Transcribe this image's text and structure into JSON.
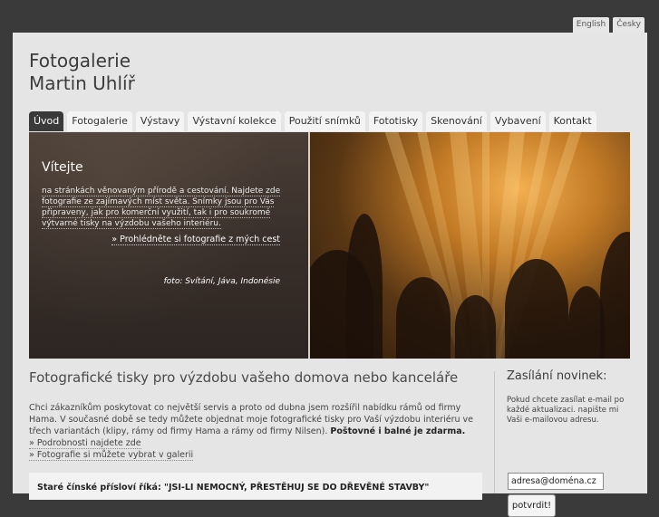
{
  "languages": [
    {
      "label": "English"
    },
    {
      "label": "Česky"
    }
  ],
  "site": {
    "title_line1": "Fotogalerie",
    "title_line2": "Martin Uhlíř"
  },
  "nav": {
    "tabs": [
      {
        "label": "Úvod",
        "active": true
      },
      {
        "label": "Fotogalerie"
      },
      {
        "label": "Výstavy"
      },
      {
        "label": "Výstavní kolekce"
      },
      {
        "label": "Použití snímků"
      },
      {
        "label": "Fototisky"
      },
      {
        "label": "Skenování"
      },
      {
        "label": "Vybavení"
      },
      {
        "label": "Kontakt"
      }
    ]
  },
  "hero": {
    "heading": "Vítejte",
    "text": "na stránkách věnovaným přírodě a cestování. Najdete zde fotografie ze zajímavých míst světa. Snímky jsou pro Vás připraveny, jak pro komerční využití, tak i pro soukromé výtvarné tisky na výzdobu vašeho interiéru.",
    "link": "» Prohlédněte si fotografie z mých cest",
    "caption": "foto: Svítání, Jáva, Indonésie"
  },
  "main": {
    "heading": "Fotografické tisky pro výzdobu vašeho domova nebo kanceláře",
    "paragraph": "Chci zákazníkům poskytovat co největší servis a proto od dubna jsem rozšířil nabídku rámů od firmy Hama. V současné době se tedy můžete objednat moje fotografické tisky pro Vaší výzdobu interiéru ve třech variantách (klipy, rámy od firmy Hama a rámy od firmy Nilsen).",
    "paragraph_bold": "Poštovné i balné je zdarma.",
    "link_details": "» Podrobnosti najdete zde",
    "link_gallery": "» Fotografie si můžete vybrat v galerii",
    "proverb": "Staré čínské přísloví říká: \"JSI-LI NEMOCNÝ, PŘESTĚHUJ SE DO DŘEVĚNÉ STAVBY\""
  },
  "newsletter": {
    "heading": "Zasílání novinek:",
    "text": "Pokud chcete zasílat e-mail po každé aktualizaci. napište mi Vaši e-mailovou adresu.",
    "email_value": "adresa@doména.cz",
    "submit_label": "potvrdit!"
  },
  "colors": {
    "background": "#3a3a3a",
    "page": "#e5e5e5",
    "active_tab": "#3a3a3a",
    "tab": "#f4f4f4"
  }
}
